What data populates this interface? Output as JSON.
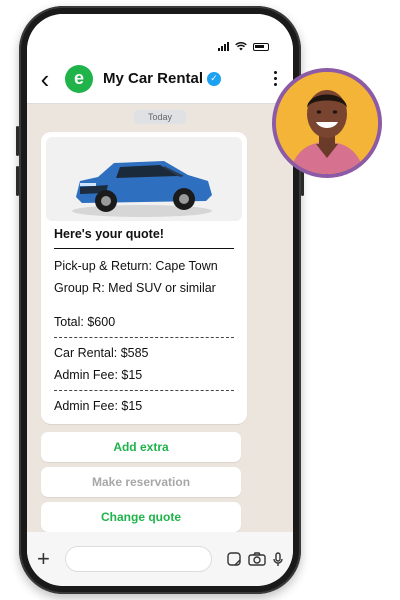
{
  "header": {
    "business_name": "My Car Rental",
    "logo_letter": "e"
  },
  "chat": {
    "date_label": "Today",
    "quote": {
      "title": "Here's your quote!",
      "pickup_return": "Pick-up & Return: Cape Town",
      "group": "Group R: Med SUV or similar",
      "total": "Total: $600",
      "car_rental": "Car Rental: $585",
      "admin_fee_1": "Admin Fee: $15",
      "admin_fee_2": "Admin Fee: $15"
    },
    "actions": [
      {
        "label": "Add extra",
        "enabled": true
      },
      {
        "label": "Make reservation",
        "enabled": false
      },
      {
        "label": "Change quote",
        "enabled": true
      }
    ]
  },
  "icons": {
    "back": "chevron-left-icon",
    "menu": "more-vertical-icon",
    "verified": "verified-badge-icon",
    "plus": "plus-icon",
    "sticker": "sticker-icon",
    "camera": "camera-icon",
    "mic": "microphone-icon"
  },
  "colors": {
    "brand_green": "#1fb34a",
    "chat_background": "#ece5dd",
    "verified_blue": "#1da1f2",
    "avatar_ring": "#8d5aa6",
    "avatar_bg": "#f3b437"
  }
}
